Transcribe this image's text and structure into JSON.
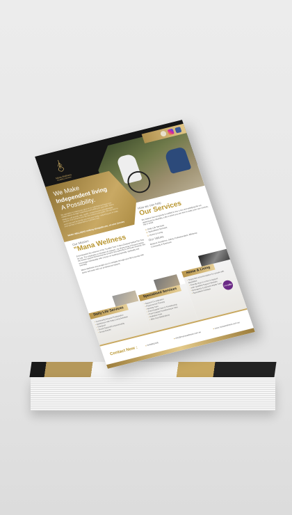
{
  "flyer": {
    "brand": {
      "name": "Mana Wellness",
      "tagline": "Disability Services"
    },
    "social_icons": [
      "globe-icon",
      "instagram-icon",
      "facebook-icon"
    ],
    "hero": {
      "line1": "We Make",
      "line2": "Independent living",
      "line3": "A Possibility.",
      "body": "We specialise in helping you grow as an individual and keep your independence through supporting and building on your skills. Mana Wellness will provide safe, quality, comprehensive and affordable services that enhance your life and achieve your goals. We are here to assist you and be beside you and your family, supporting you to make your journey to independence a positive one.",
      "tagline": "MANA WELLNESS walking alongside you, on your journey"
    },
    "mission": {
      "label": "Our Mission",
      "title": "\"Mana Wellness",
      "body1": "Encompasses the essence of the \"Koeffiel Tree\" A New Zealand Native/The Tree Of Life. The emphasis on miracles do happen - by blossoming of flowers before the leaves appear! Enhancing the powers and authority to all those involved. We encourage individuality with a focus on healing physically, spiritually and mentally.",
      "body2": "Mana Wellness encourages you to navigate through your life's journey with grace and ease with our professional support."
    },
    "services": {
      "label": "How we can help",
      "title": "Our Services",
      "body": "We believe that everybody is entitled to live a rich and satisfying life not determined by disability, a life in which you are free to make your own choices, big or small.",
      "items": [
        "Daily Life Services",
        "Specialised Services",
        "Home & Living"
      ],
      "values_label": "Our Values",
      "values": "Respect, Excellence, Safety, Professionalism, Efficiency, Community & Teamwork"
    },
    "boxes": [
      {
        "title": "Daily Life Services",
        "items": [
          "Community Access/ Participation",
          "Assistance with Daily Living Activities",
          "Transport",
          "Social Support/Companionship",
          "Group Events"
        ]
      },
      {
        "title": "Specialised Services",
        "items": [
          "Support Co-ordination",
          "Psychosocial Therapy",
          "Nursing Care",
          "Post Hospital Care & Transitioning",
          "Post Hospital Transitioning & Care",
          "Palliative Care",
          "After hour Medications"
        ]
      },
      {
        "title": "Home & Living",
        "items": [
          "Supported accommodation for people with disabilities",
          "Friendly drop in or live in support",
          "with Qualified Support Workers",
          "Emergency & planned respite Care",
          "Specialised Holidays"
        ]
      }
    ],
    "ndis_badge": "I ♥ ndis",
    "footer": {
      "contact_label": "Contact Now :",
      "phone": "0448802446",
      "email": "info@manawellness.com.au",
      "website": "www.manawellness.com.au"
    }
  }
}
